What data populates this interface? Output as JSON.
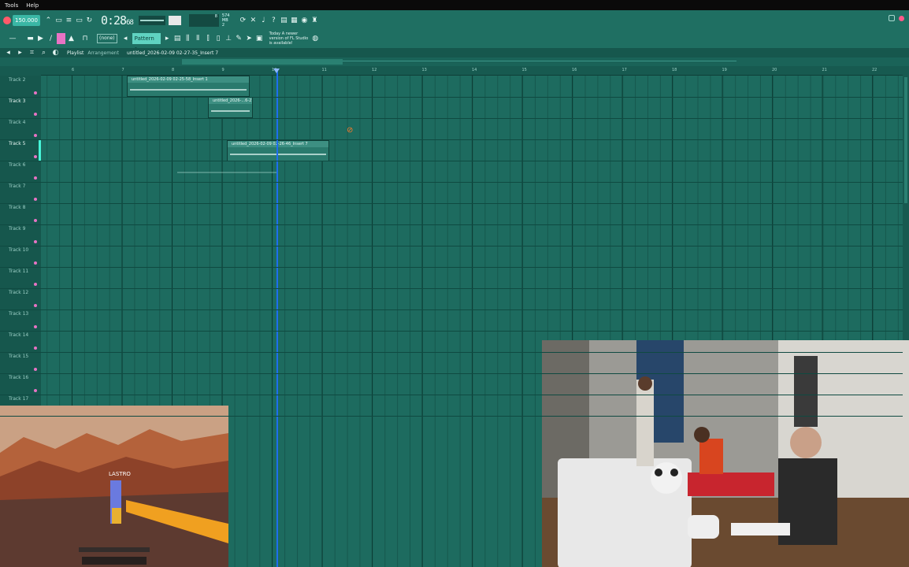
{
  "menu": {
    "items": [
      "Tools",
      "Help"
    ]
  },
  "toolbar": {
    "tempo": "150.000",
    "time": "0:28",
    "time_sub": "68",
    "cpu_value": "8",
    "memory": "574 MB",
    "memory_sub": "2",
    "snap_mode": "(none)",
    "pattern": "Pattern 1",
    "news_text": "Today  A newer version of FL Studio is available!"
  },
  "playlist": {
    "title": "Playlist",
    "subtitle": "Arrangement",
    "file": "untitled_2026-02-09 02-27-35_Insert 7"
  },
  "ruler": [
    "6",
    "7",
    "8",
    "9",
    "10",
    "11",
    "12",
    "13",
    "14",
    "15",
    "16",
    "17",
    "18",
    "19",
    "20",
    "21",
    "22"
  ],
  "tracks": [
    {
      "name": "Track 2",
      "active": false
    },
    {
      "name": "Track 3",
      "active": true
    },
    {
      "name": "Track 4",
      "active": false
    },
    {
      "name": "Track 5",
      "active": true
    },
    {
      "name": "Track 6",
      "active": false
    },
    {
      "name": "Track 7",
      "active": false
    },
    {
      "name": "Track 8",
      "active": false
    },
    {
      "name": "Track 9",
      "active": false
    },
    {
      "name": "Track 10",
      "active": false
    },
    {
      "name": "Track 11",
      "active": false
    },
    {
      "name": "Track 12",
      "active": false
    },
    {
      "name": "Track 13",
      "active": false
    },
    {
      "name": "Track 14",
      "active": false
    },
    {
      "name": "Track 15",
      "active": false
    },
    {
      "name": "Track 16",
      "active": false
    },
    {
      "name": "Track 17",
      "active": false
    }
  ],
  "clips": [
    {
      "label": "untitled_2026-02-09 02-25-58_Insert 1"
    },
    {
      "label": "untitled_2026-...6-21_Insert 7"
    },
    {
      "label": "untitled_2026-02-09 02-26-46_Insert 7"
    }
  ],
  "game": {
    "player_tag": "LASTRO"
  },
  "colors": {
    "toolbar": "#1f6f62",
    "grid": "#1d6b5f",
    "playhead": "#1e6ef0",
    "accent_pink": "#e873c4",
    "accent_cyan": "#46f5d8"
  }
}
